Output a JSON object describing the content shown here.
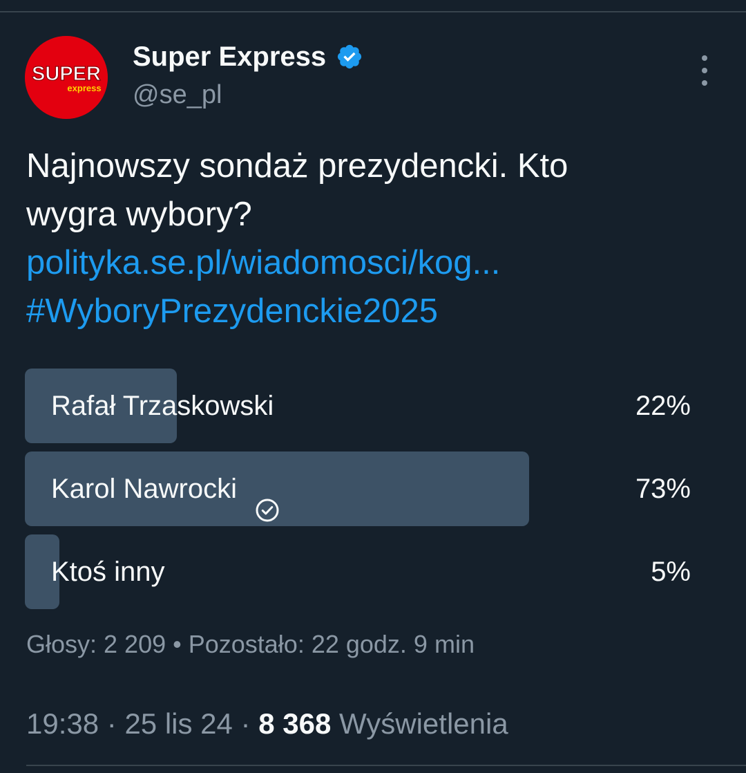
{
  "author": {
    "name": "Super Express",
    "handle": "@se_pl",
    "logo_text_main": "SUPER",
    "logo_text_sub": "express",
    "verified": true
  },
  "tweet": {
    "text_line1": "Najnowszy sondaż prezydencki. Kto",
    "text_line2": "wygra wybory?",
    "link": "polityka.se.pl/wiadomosci/kog...",
    "hashtag": "#WyboryPrezydenckie2025"
  },
  "poll": {
    "options": [
      {
        "label": "Rafał Trzaskowski",
        "percent_label": "22%",
        "percent": 22,
        "winner": false
      },
      {
        "label": "Karol Nawrocki",
        "percent_label": "73%",
        "percent": 73,
        "winner": true
      },
      {
        "label": "Ktoś inny",
        "percent_label": "5%",
        "percent": 5,
        "winner": false
      }
    ],
    "meta": "Głosy: 2 209 • Pozostało: 22 godz. 9 min"
  },
  "footer": {
    "time": "19:38",
    "separator": " · ",
    "date": "25 lis 24",
    "views_count": "8 368",
    "views_label": "Wyświetlenia"
  },
  "colors": {
    "background": "#15202b",
    "bar": "#3d5266",
    "link": "#1d9bf0",
    "muted": "#8b98a5",
    "brand_red": "#e3000f"
  },
  "icons": {
    "verified": "verified-badge-icon",
    "more": "more-vertical-icon",
    "winner": "check-circle-icon"
  }
}
